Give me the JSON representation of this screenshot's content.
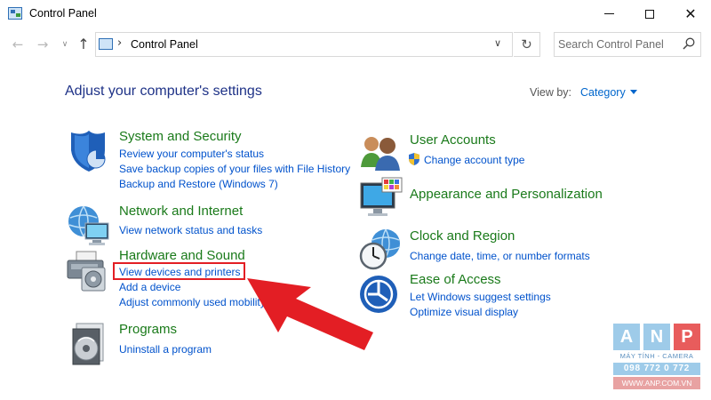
{
  "window": {
    "title": "Control Panel",
    "minimize_glyph": "",
    "close_glyph": "✕"
  },
  "nav": {
    "back_glyph": "←",
    "forward_glyph": "→",
    "recent_glyph": "∨",
    "up_glyph": "↑",
    "separator": "›",
    "path": "Control Panel",
    "address_dropdown_glyph": "∨",
    "refresh_glyph": "↻",
    "search_placeholder": "Search Control Panel"
  },
  "header": {
    "title": "Adjust your computer's settings",
    "view_by_label": "View by:",
    "view_by_value": "Category"
  },
  "categories": {
    "system_security": {
      "title": "System and Security",
      "links": [
        "Review your computer's status",
        "Save backup copies of your files with File History",
        "Backup and Restore (Windows 7)"
      ]
    },
    "network": {
      "title": "Network and Internet",
      "links": [
        "View network status and tasks"
      ]
    },
    "hardware": {
      "title": "Hardware and Sound",
      "links": [
        "View devices and printers",
        "Add a device",
        "Adjust commonly used mobility"
      ]
    },
    "programs": {
      "title": "Programs",
      "links": [
        "Uninstall a program"
      ]
    },
    "user_accounts": {
      "title": "User Accounts",
      "links": [
        "Change account type"
      ]
    },
    "appearance": {
      "title": "Appearance and Personalization",
      "links": []
    },
    "clock": {
      "title": "Clock and Region",
      "links": [
        "Change date, time, or number formats"
      ]
    },
    "ease": {
      "title": "Ease of Access",
      "links": [
        "Let Windows suggest settings",
        "Optimize visual display"
      ]
    }
  },
  "annotation": {
    "highlight_color": "#e31e24",
    "arrow_color": "#e31e24"
  },
  "watermark": {
    "letters": [
      "A",
      "N",
      "P"
    ],
    "subtitle": "MÁY TÍNH - CAMERA",
    "phone": "098 772 0 772",
    "website": "WWW.ANP.COM.VN"
  },
  "colors": {
    "link": "#0052cc",
    "category_heading": "#1a7a1a",
    "page_heading": "#1e3287"
  }
}
